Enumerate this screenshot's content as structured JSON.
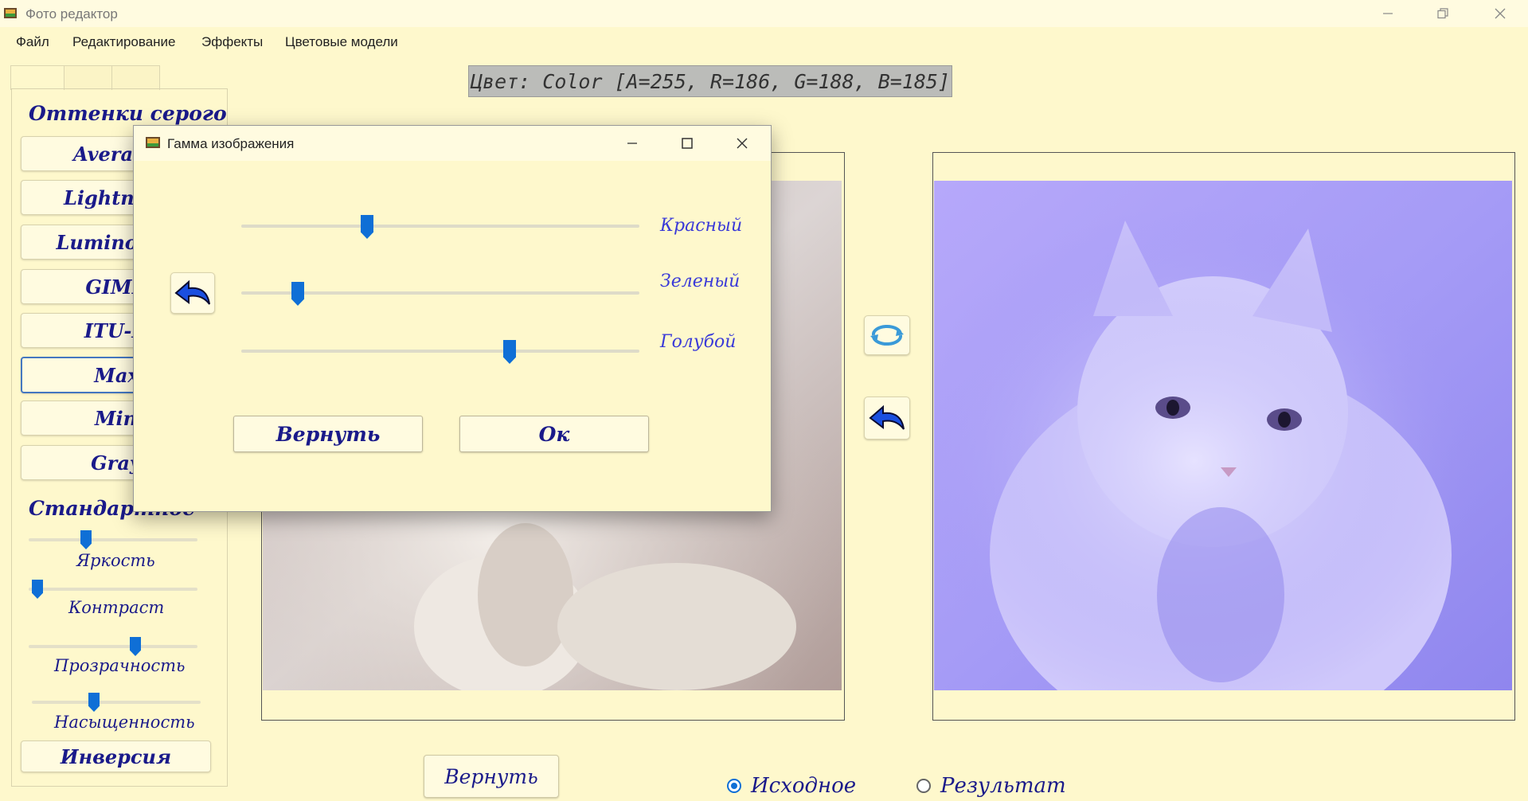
{
  "window": {
    "title": "Фото редактор",
    "controls": [
      "minimize-icon",
      "restore-icon",
      "close-icon"
    ]
  },
  "menu": [
    "Файл",
    "Редактирование",
    "Эффекты",
    "Цветовые модели"
  ],
  "color_readout": "Цвет: Color [A=255, R=186, G=188, B=185]",
  "left_panel": {
    "grayscale_title": "Оттенки серого",
    "grayscale_buttons": [
      "Average",
      "Lightness",
      "Luminosity",
      "GIMP",
      "ITU-R",
      "Max",
      "Min",
      "Gray"
    ],
    "selected_button": "Max",
    "standard_title": "Стандартное",
    "sliders": [
      {
        "label": "Яркость",
        "value": 0.33
      },
      {
        "label": "Контраст",
        "value": 0.02
      },
      {
        "label": "Прозрачность",
        "value": 0.64
      },
      {
        "label": "Насыщенность",
        "value": 0.36
      }
    ],
    "inversion_button": "Инверсия"
  },
  "bottom": {
    "revert_button": "Вернуть",
    "radio": [
      {
        "label": "Исходное",
        "checked": true
      },
      {
        "label": "Результат",
        "checked": false
      }
    ]
  },
  "dialog": {
    "title": "Гамма изображения",
    "controls": [
      "minimize-icon",
      "maximize-icon",
      "close-icon"
    ],
    "sliders": [
      {
        "label": "Красный",
        "value": 0.31
      },
      {
        "label": "Зеленый",
        "value": 0.13
      },
      {
        "label": "Голубой",
        "value": 0.68
      }
    ],
    "revert_button": "Вернуть",
    "ok_button": "Ок"
  },
  "colors": {
    "background": "#fef8cc",
    "accent": "#0f6fd6",
    "text_label": "#1a1a8a",
    "result_tint": "#8f86f5"
  }
}
